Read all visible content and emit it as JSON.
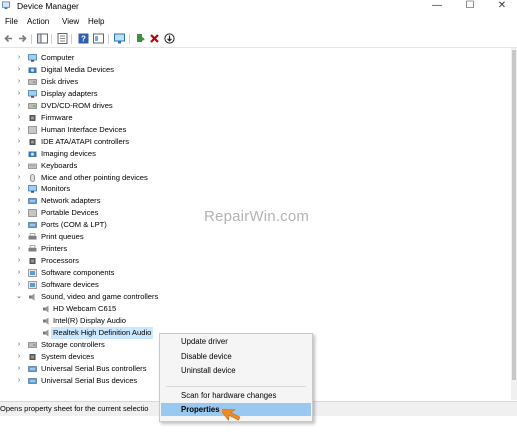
{
  "window": {
    "title": "Device Manager",
    "minimize": "—",
    "maximize": "☐",
    "close": "✕"
  },
  "menu": {
    "items": [
      "File",
      "Action",
      "View",
      "Help"
    ]
  },
  "toolbar": {
    "icons": [
      "back-arrow-icon",
      "forward-arrow-icon",
      "show-hide-console-tree-icon",
      "properties-sheet-icon",
      "help-icon",
      "view-icon",
      "scan-hardware-icon",
      "update-driver-icon",
      "uninstall-x-icon",
      "disable-device-icon"
    ],
    "accent": "#c00000"
  },
  "tree": {
    "categories": [
      {
        "label": "Computer",
        "icon": "computer-icon",
        "expanded": false
      },
      {
        "label": "Digital Media Devices",
        "icon": "media-device-icon",
        "expanded": false
      },
      {
        "label": "Disk drives",
        "icon": "disk-drive-icon",
        "expanded": false
      },
      {
        "label": "Display adapters",
        "icon": "display-adapter-icon",
        "expanded": false
      },
      {
        "label": "DVD/CD-ROM drives",
        "icon": "dvd-drive-icon",
        "expanded": false
      },
      {
        "label": "Firmware",
        "icon": "firmware-icon",
        "expanded": false
      },
      {
        "label": "Human Interface Devices",
        "icon": "hid-icon",
        "expanded": false
      },
      {
        "label": "IDE ATA/ATAPI controllers",
        "icon": "ide-controller-icon",
        "expanded": false
      },
      {
        "label": "Imaging devices",
        "icon": "camera-icon",
        "expanded": false
      },
      {
        "label": "Keyboards",
        "icon": "keyboard-icon",
        "expanded": false
      },
      {
        "label": "Mice and other pointing devices",
        "icon": "mouse-icon",
        "expanded": false
      },
      {
        "label": "Monitors",
        "icon": "monitor-icon",
        "expanded": false
      },
      {
        "label": "Network adapters",
        "icon": "network-adapter-icon",
        "expanded": false
      },
      {
        "label": "Portable Devices",
        "icon": "portable-device-icon",
        "expanded": false
      },
      {
        "label": "Ports (COM & LPT)",
        "icon": "port-icon",
        "expanded": false
      },
      {
        "label": "Print queues",
        "icon": "printer-icon",
        "expanded": false
      },
      {
        "label": "Printers",
        "icon": "printer-icon",
        "expanded": false
      },
      {
        "label": "Processors",
        "icon": "processor-icon",
        "expanded": false
      },
      {
        "label": "Software components",
        "icon": "software-component-icon",
        "expanded": false
      },
      {
        "label": "Software devices",
        "icon": "software-device-icon",
        "expanded": false
      },
      {
        "label": "Sound, video and game controllers",
        "icon": "speaker-icon",
        "expanded": true,
        "children": [
          {
            "label": "HD Webcam C615",
            "icon": "speaker-icon",
            "selected": false
          },
          {
            "label": "Intel(R) Display Audio",
            "icon": "speaker-icon",
            "selected": false
          },
          {
            "label": "Realtek High Definition Audio",
            "icon": "speaker-icon",
            "selected": true
          }
        ]
      },
      {
        "label": "Storage controllers",
        "icon": "storage-controller-icon",
        "expanded": false
      },
      {
        "label": "System devices",
        "icon": "system-device-icon",
        "expanded": false
      },
      {
        "label": "Universal Serial Bus controllers",
        "icon": "usb-icon",
        "expanded": false
      },
      {
        "label": "Universal Serial Bus devices",
        "icon": "usb-icon",
        "expanded": false
      }
    ]
  },
  "context_menu": {
    "items": [
      {
        "label": "Update driver",
        "highlighted": false
      },
      {
        "label": "Disable device",
        "highlighted": false
      },
      {
        "label": "Uninstall device",
        "highlighted": false
      },
      {
        "separator": true
      },
      {
        "label": "Scan for hardware changes",
        "highlighted": false
      },
      {
        "separator": true
      },
      {
        "label": "Properties",
        "highlighted": true
      }
    ]
  },
  "status": {
    "text": "Opens property sheet for the current selectio"
  },
  "watermark": {
    "text": "RepairWin.com"
  },
  "colors": {
    "selection": "#cce8ff",
    "context_highlight": "#99c9f1",
    "arrow": "#f08a24"
  }
}
